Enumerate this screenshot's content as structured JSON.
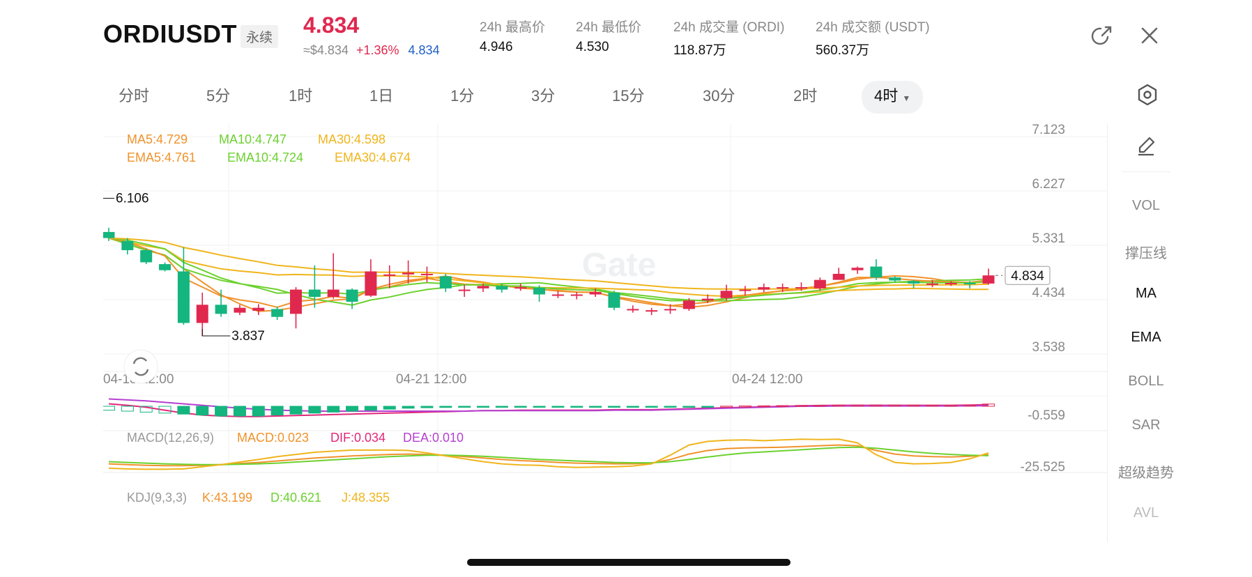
{
  "header": {
    "symbol": "ORDIUSDT",
    "contract_type": "永续",
    "last_price": "4.834",
    "usd_price": "≈$4.834",
    "change_pct": "+1.36%",
    "mark_price": "4.834",
    "stats": [
      {
        "label": "24h 最高价",
        "value": "4.946"
      },
      {
        "label": "24h 最低价",
        "value": "4.530"
      },
      {
        "label": "24h 成交量 (ORDI)",
        "value": "118.87万"
      },
      {
        "label": "24h 成交额 (USDT)",
        "value": "560.37万"
      }
    ],
    "icons": {
      "share": "external-link-icon",
      "close": "close-icon"
    }
  },
  "intervals": [
    "分时",
    "5分",
    "1时",
    "1日",
    "1分",
    "3分",
    "15分",
    "30分",
    "2时",
    "4时"
  ],
  "active_interval": "4时",
  "right_menu": [
    "VOL",
    "撑压线",
    "MA",
    "EMA",
    "BOLL",
    "SAR",
    "超级趋势",
    "AVL"
  ],
  "active_right": [
    "MA",
    "EMA"
  ],
  "disabled_right": [
    "AVL"
  ],
  "watermark": "Gate",
  "colors": {
    "up": "#e0284f",
    "down": "#14b57f",
    "ma5": "#f0922b",
    "ma10": "#6cd12f",
    "ma30": "#f0b51c",
    "macd": "#f0922b",
    "dif": "#e0287a",
    "dea": "#b53fd1",
    "k": "#f0922b",
    "d": "#6cd12f",
    "j": "#f0b51c"
  },
  "chart_data": {
    "type": "candlestick",
    "x_labels": [
      "04-18 12:00",
      "04-21 12:00",
      "04-24 12:00"
    ],
    "y_ticks": [
      "7.123",
      "6.227",
      "5.331",
      "4.434",
      "3.538"
    ],
    "ylim": [
      3.538,
      7.123
    ],
    "current_price_label": "4.834",
    "high_marker": "6.106",
    "low_marker": "3.837",
    "indicators": {
      "ma": [
        {
          "name": "MA5",
          "text": "MA5:4.729"
        },
        {
          "name": "MA10",
          "text": "MA10:4.747"
        },
        {
          "name": "MA30",
          "text": "MA30:4.598"
        }
      ],
      "ema": [
        {
          "name": "EMA5",
          "text": "EMA5:4.761"
        },
        {
          "name": "EMA10",
          "text": "EMA10:4.724"
        },
        {
          "name": "EMA30",
          "text": "EMA30:4.674"
        }
      ]
    },
    "candles": [
      [
        5.55,
        5.45,
        5.62,
        5.4
      ],
      [
        5.4,
        5.25,
        5.45,
        5.18
      ],
      [
        5.25,
        5.05,
        5.28,
        5.02
      ],
      [
        5.02,
        4.92,
        5.05,
        4.9
      ],
      [
        4.9,
        4.05,
        5.3,
        4.02
      ],
      [
        4.05,
        4.35,
        4.55,
        3.837
      ],
      [
        4.35,
        4.2,
        4.6,
        4.15
      ],
      [
        4.22,
        4.3,
        4.35,
        4.18
      ],
      [
        4.25,
        4.3,
        4.36,
        4.18
      ],
      [
        4.28,
        4.15,
        4.32,
        4.1
      ],
      [
        4.2,
        4.6,
        4.64,
        3.96
      ],
      [
        4.6,
        4.48,
        5.0,
        4.3
      ],
      [
        4.48,
        4.6,
        5.2,
        4.45
      ],
      [
        4.6,
        4.4,
        4.62,
        4.28
      ],
      [
        4.5,
        4.9,
        5.1,
        4.48
      ],
      [
        4.85,
        4.85,
        5.0,
        4.62
      ],
      [
        4.85,
        4.88,
        5.08,
        4.7
      ],
      [
        4.86,
        4.86,
        4.98,
        4.72
      ],
      [
        4.82,
        4.62,
        4.86,
        4.56
      ],
      [
        4.6,
        4.6,
        4.68,
        4.48
      ],
      [
        4.62,
        4.66,
        4.7,
        4.56
      ],
      [
        4.66,
        4.6,
        4.7,
        4.55
      ],
      [
        4.62,
        4.64,
        4.7,
        4.58
      ],
      [
        4.63,
        4.52,
        4.67,
        4.4
      ],
      [
        4.52,
        4.52,
        4.58,
        4.46
      ],
      [
        4.5,
        4.52,
        4.56,
        4.44
      ],
      [
        4.52,
        4.56,
        4.62,
        4.48
      ],
      [
        4.55,
        4.3,
        4.58,
        4.26
      ],
      [
        4.28,
        4.28,
        4.34,
        4.22
      ],
      [
        4.26,
        4.26,
        4.3,
        4.18
      ],
      [
        4.26,
        4.28,
        4.36,
        4.2
      ],
      [
        4.28,
        4.42,
        4.46,
        4.25
      ],
      [
        4.42,
        4.45,
        4.52,
        4.38
      ],
      [
        4.46,
        4.58,
        4.68,
        4.42
      ],
      [
        4.58,
        4.6,
        4.66,
        4.5
      ],
      [
        4.6,
        4.64,
        4.7,
        4.56
      ],
      [
        4.62,
        4.64,
        4.7,
        4.56
      ],
      [
        4.63,
        4.64,
        4.72,
        4.58
      ],
      [
        4.62,
        4.76,
        4.8,
        4.58
      ],
      [
        4.76,
        4.86,
        4.96,
        4.78
      ],
      [
        4.92,
        4.96,
        4.98,
        4.86
      ],
      [
        4.98,
        4.8,
        5.1,
        4.76
      ],
      [
        4.8,
        4.75,
        4.82,
        4.72
      ],
      [
        4.74,
        4.7,
        4.76,
        4.62
      ],
      [
        4.7,
        4.7,
        4.76,
        4.64
      ],
      [
        4.7,
        4.71,
        4.74,
        4.66
      ],
      [
        4.71,
        4.7,
        4.74,
        4.62
      ],
      [
        4.7,
        4.834,
        4.946,
        4.68
      ]
    ],
    "macd": {
      "label": "MACD(12,26,9)",
      "macd_text": "MACD:0.023",
      "dif_text": "DIF:0.034",
      "dea_text": "DEA:0.010",
      "y_tick": "-0.559",
      "hist": [
        -0.04,
        -0.05,
        -0.06,
        -0.07,
        -0.08,
        -0.09,
        -0.1,
        -0.1,
        -0.1,
        -0.09,
        -0.08,
        -0.07,
        -0.06,
        -0.05,
        -0.04,
        -0.03,
        -0.02,
        -0.015,
        -0.012,
        -0.01,
        -0.01,
        -0.01,
        -0.01,
        -0.01,
        -0.01,
        -0.01,
        -0.01,
        -0.01,
        -0.01,
        -0.01,
        -0.008,
        -0.005,
        -0.002,
        0.001,
        0.003,
        0.005,
        0.007,
        0.009,
        0.011,
        0.012,
        0.013,
        0.014,
        0.013,
        0.012,
        0.011,
        0.01,
        0.012,
        0.023
      ],
      "dif": [
        0.05,
        0.02,
        -0.02,
        -0.08,
        -0.14,
        -0.18,
        -0.2,
        -0.21,
        -0.21,
        -0.2,
        -0.19,
        -0.18,
        -0.17,
        -0.16,
        -0.15,
        -0.14,
        -0.13,
        -0.12,
        -0.11,
        -0.1,
        -0.09,
        -0.09,
        -0.08,
        -0.08,
        -0.08,
        -0.08,
        -0.08,
        -0.07,
        -0.07,
        -0.07,
        -0.06,
        -0.05,
        -0.04,
        -0.03,
        -0.02,
        -0.01,
        0.0,
        0.01,
        0.015,
        0.02,
        0.02,
        0.02,
        0.02,
        0.02,
        0.02,
        0.02,
        0.025,
        0.034
      ],
      "dea": [
        0.15,
        0.13,
        0.11,
        0.08,
        0.05,
        0.02,
        -0.01,
        -0.04,
        -0.06,
        -0.08,
        -0.09,
        -0.1,
        -0.1,
        -0.1,
        -0.1,
        -0.1,
        -0.1,
        -0.1,
        -0.1,
        -0.1,
        -0.09,
        -0.09,
        -0.09,
        -0.09,
        -0.09,
        -0.09,
        -0.09,
        -0.08,
        -0.08,
        -0.08,
        -0.07,
        -0.06,
        -0.05,
        -0.04,
        -0.03,
        -0.02,
        -0.01,
        0.0,
        0.0,
        0.005,
        0.005,
        0.005,
        0.005,
        0.005,
        0.005,
        0.005,
        0.008,
        0.01
      ]
    },
    "kdj": {
      "label": "KDJ(9,3,3)",
      "k_text": "K:43.199",
      "d_text": "D:40.621",
      "j_text": "J:48.355",
      "y_tick": "-25.525",
      "k": [
        18,
        16,
        14,
        13,
        13,
        14,
        16,
        19,
        22,
        26,
        30,
        34,
        37,
        40,
        42,
        44,
        45,
        44,
        42,
        38,
        34,
        30,
        27,
        25,
        22,
        20,
        19,
        18,
        18,
        20,
        30,
        45,
        55,
        60,
        62,
        63,
        64,
        66,
        68,
        70,
        68,
        55,
        45,
        40,
        38,
        37,
        39,
        43.199
      ],
      "d": [
        24,
        22,
        20,
        18,
        17,
        16,
        16,
        17,
        18,
        20,
        23,
        26,
        29,
        32,
        35,
        38,
        40,
        42,
        42,
        41,
        39,
        36,
        33,
        30,
        28,
        26,
        24,
        22,
        21,
        21,
        24,
        30,
        37,
        43,
        48,
        51,
        54,
        57,
        60,
        63,
        64,
        61,
        56,
        51,
        47,
        44,
        42,
        40.621
      ],
      "j": [
        6,
        4,
        3,
        3,
        4,
        10,
        16,
        23,
        30,
        38,
        44,
        50,
        53,
        56,
        56,
        56,
        55,
        48,
        40,
        32,
        24,
        18,
        15,
        14,
        10,
        8,
        9,
        10,
        12,
        18,
        42,
        70,
        80,
        83,
        84,
        82,
        84,
        86,
        85,
        86,
        76,
        43,
        22,
        18,
        19,
        22,
        32,
        48.355
      ]
    }
  }
}
